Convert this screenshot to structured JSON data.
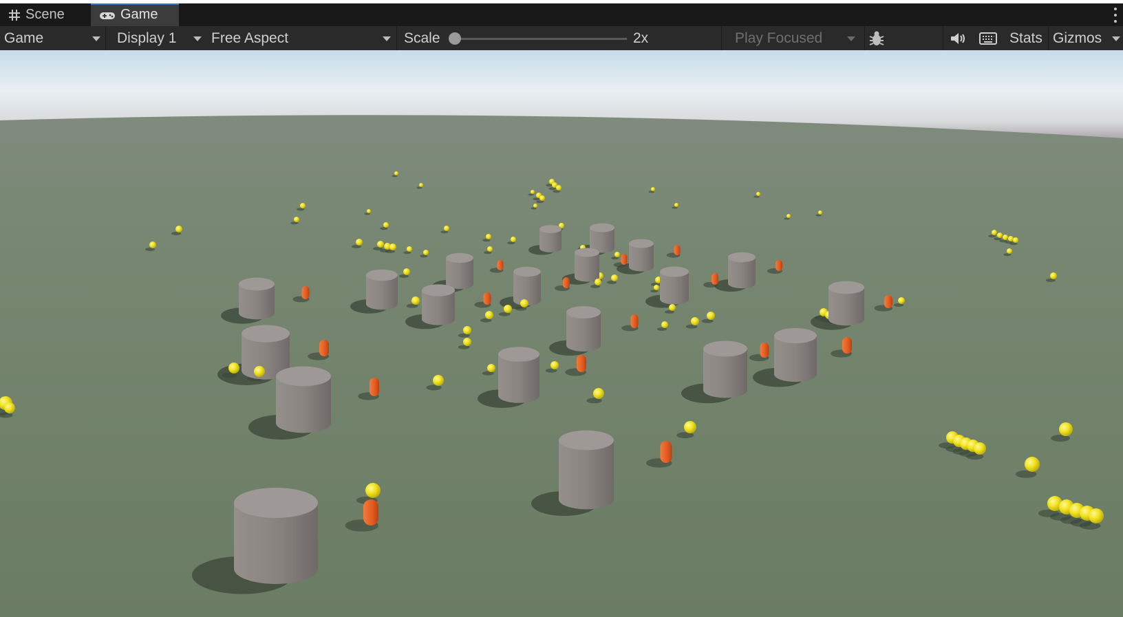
{
  "tabs": [
    {
      "label": "Scene",
      "icon": "grid-icon",
      "active": false
    },
    {
      "label": "Game",
      "icon": "gamepad-icon",
      "active": true
    }
  ],
  "toolbar": {
    "display_mode": "Game",
    "display": "Display 1",
    "aspect": "Free Aspect",
    "scale_label": "Scale",
    "scale_value": "2x",
    "play_mode": "Play Focused",
    "stats_label": "Stats",
    "gizmos_label": "Gizmos",
    "icons": [
      "bug-icon",
      "speaker-icon",
      "keyboard-icon"
    ]
  },
  "scene": {
    "sky_color": "#cfe3ee",
    "ground_color": "#6f7f6a",
    "pillar_color": "#8c8684",
    "agent_color": "#e85a22",
    "pickup_color": "#f3e31b"
  }
}
